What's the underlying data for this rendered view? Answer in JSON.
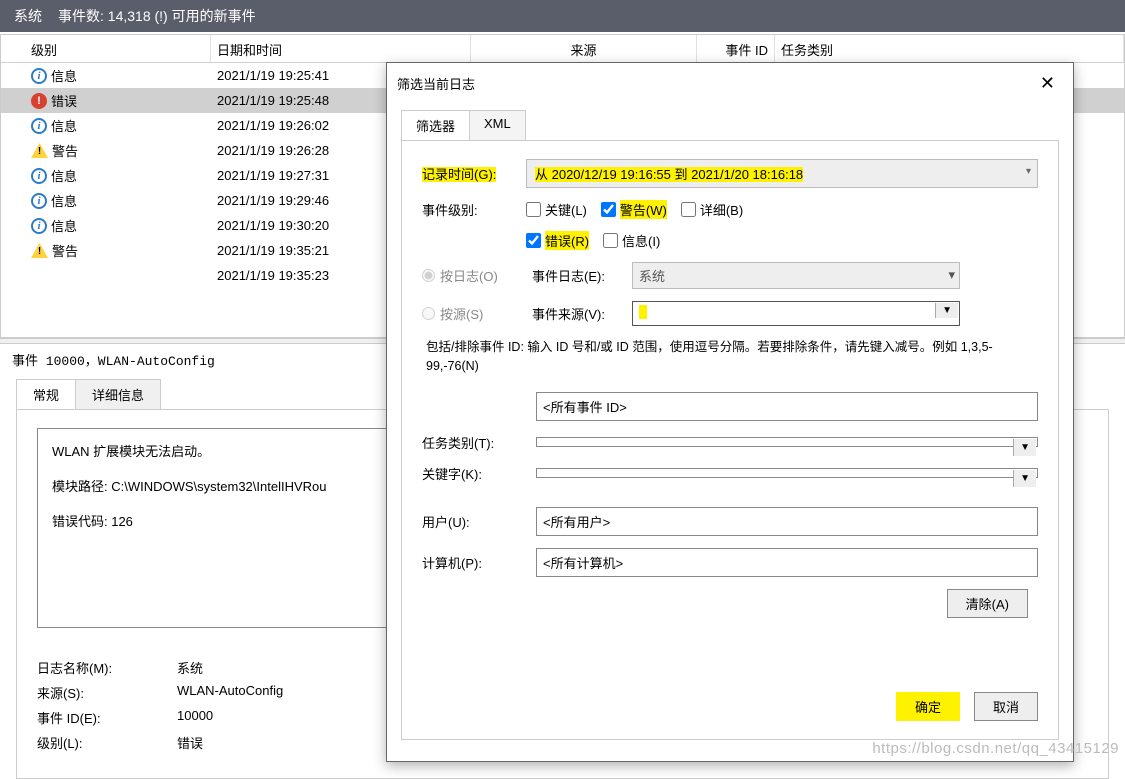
{
  "titlebar": {
    "title": "系统",
    "events_count": "事件数: 14,318 (!) 可用的新事件"
  },
  "grid": {
    "headers": {
      "level": "级别",
      "datetime": "日期和时间",
      "source": "来源",
      "event_id": "事件 ID",
      "category": "任务类别"
    },
    "rows": [
      {
        "icon": "info",
        "level": "信息",
        "dt": "2021/1/19 19:25:41",
        "sel": false
      },
      {
        "icon": "err",
        "level": "错误",
        "dt": "2021/1/19 19:25:48",
        "sel": true
      },
      {
        "icon": "info",
        "level": "信息",
        "dt": "2021/1/19 19:26:02",
        "sel": false
      },
      {
        "icon": "warn",
        "level": "警告",
        "dt": "2021/1/19 19:26:28",
        "sel": false
      },
      {
        "icon": "info",
        "level": "信息",
        "dt": "2021/1/19 19:27:31",
        "sel": false
      },
      {
        "icon": "info",
        "level": "信息",
        "dt": "2021/1/19 19:29:46",
        "sel": false
      },
      {
        "icon": "info",
        "level": "信息",
        "dt": "2021/1/19 19:30:20",
        "sel": false
      },
      {
        "icon": "warn",
        "level": "警告",
        "dt": "2021/1/19 19:35:21",
        "sel": false
      },
      {
        "icon": null,
        "level": "",
        "dt": "2021/1/19 19:35:23",
        "sel": false
      }
    ]
  },
  "detail": {
    "title": "事件 10000，WLAN-AutoConfig",
    "tabs": {
      "general": "常规",
      "details": "详细信息"
    },
    "body": {
      "l1": "WLAN 扩展模块无法启动。",
      "l2": "模块路径: C:\\WINDOWS\\system32\\IntelIHVRou",
      "l3": "错误代码: 126"
    },
    "meta": {
      "log_name_l": "日志名称(M):",
      "log_name_v": "系统",
      "source_l": "来源(S):",
      "source_v": "WLAN-AutoConfig",
      "eid_l": "事件 ID(E):",
      "eid_v": "10000",
      "level_l": "级别(L):",
      "level_v": "错误"
    }
  },
  "dialog": {
    "title": "筛选当前日志",
    "tabs": {
      "filter": "筛选器",
      "xml": "XML"
    },
    "time_l": "记录时间(G):",
    "time_v": "从 2020/12/19 19:16:55 到 2021/1/20 18:16:18",
    "level_l": "事件级别:",
    "chk": {
      "critical": "关键(L)",
      "warning": "警告(W)",
      "verbose": "详细(B)",
      "error": "错误(R)",
      "info": "信息(I)"
    },
    "by_log": "按日志(O)",
    "event_log_l": "事件日志(E):",
    "event_log_v": "系统",
    "by_source": "按源(S)",
    "event_source_l": "事件来源(V):",
    "help": "包括/排除事件 ID: 输入 ID 号和/或 ID 范围，使用逗号分隔。若要排除条件，请先键入减号。例如 1,3,5-99,-76(N)",
    "all_ids": "<所有事件 ID>",
    "task_l": "任务类别(T):",
    "keywords_l": "关键字(K):",
    "user_l": "用户(U):",
    "user_v": "<所有用户>",
    "computer_l": "计算机(P):",
    "computer_v": "<所有计算机>",
    "clear": "清除(A)",
    "ok": "确定",
    "cancel": "取消"
  },
  "watermark": "https://blog.csdn.net/qq_43415129"
}
